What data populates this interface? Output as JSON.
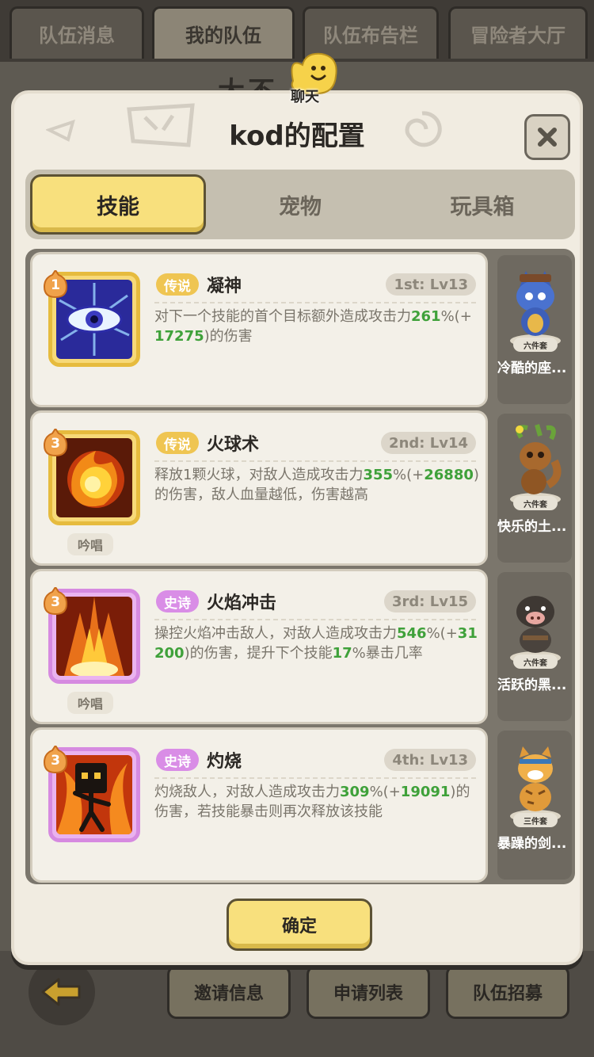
{
  "background": {
    "tabs": [
      "队伍消息",
      "我的队伍",
      "队伍布告栏",
      "冒险者大厅"
    ],
    "active_tab_index": 1,
    "team_name": "大不",
    "chat_label": "聊天",
    "bottom_buttons": [
      "邀请信息",
      "申请列表",
      "队伍招募"
    ]
  },
  "modal": {
    "title": "kod的配置",
    "tabs": [
      "技能",
      "宠物",
      "玩具箱"
    ],
    "active_tab_index": 0,
    "confirm_label": "确定",
    "skills": [
      {
        "level_badge": "1",
        "rarity": "传说",
        "rarity_color": "#efc552",
        "name": "凝神",
        "rank": "1st: Lv13",
        "desc_parts": [
          "对下一个技能的首个目标额外造成攻击力",
          "261",
          "%(+",
          "17275",
          ")的伤害"
        ],
        "chant": "",
        "icon": "eye-skill-icon"
      },
      {
        "level_badge": "3",
        "rarity": "传说",
        "rarity_color": "#efc552",
        "name": "火球术",
        "rank": "2nd: Lv14",
        "desc_parts": [
          "释放1颗火球，对敌人造成攻击力",
          "355",
          "%(+",
          "26880",
          ")的伤害，敌人血量越低，伤害越高"
        ],
        "chant": "吟唱",
        "icon": "fireball-icon"
      },
      {
        "level_badge": "3",
        "rarity": "史诗",
        "rarity_color": "#d98de6",
        "name": "火焰冲击",
        "rank": "3rd: Lv15",
        "desc_parts": [
          "操控火焰冲击敌人，对敌人造成攻击力",
          "546",
          "%(+",
          "31200",
          ")的伤害，提升下个技能",
          "17",
          "%暴击几率"
        ],
        "chant": "吟唱",
        "icon": "flame-burst-icon"
      },
      {
        "level_badge": "3",
        "rarity": "史诗",
        "rarity_color": "#d98de6",
        "name": "灼烧",
        "rank": "4th: Lv13",
        "desc_parts": [
          "灼烧敌人，对敌人造成攻击力",
          "309",
          "%(+",
          "19091",
          ")的伤害，若技能暴击则再次释放该技能"
        ],
        "chant": "",
        "icon": "burn-icon"
      }
    ],
    "pets": [
      {
        "name": "冷酷的座...",
        "set_tag": "六件套",
        "icon": "wolf-pet-icon"
      },
      {
        "name": "快乐的土...",
        "set_tag": "六件套",
        "icon": "squirrel-pet-icon"
      },
      {
        "name": "活跃的黑...",
        "set_tag": "六件套",
        "icon": "boar-pet-icon"
      },
      {
        "name": "暴躁的剑...",
        "set_tag": "三件套",
        "icon": "tiger-pet-icon"
      }
    ]
  }
}
